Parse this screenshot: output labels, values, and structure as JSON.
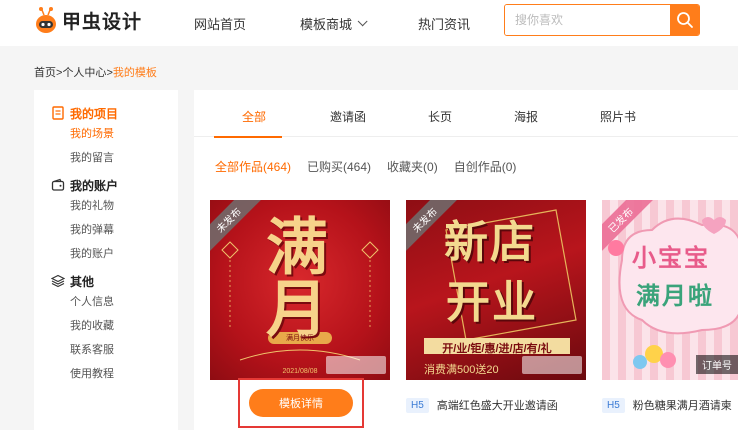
{
  "brand": {
    "name": "甲虫设计",
    "accent": "#ff7d1a"
  },
  "nav": [
    {
      "label": "网站首页"
    },
    {
      "label": "模板商城"
    },
    {
      "label": "热门资讯"
    }
  ],
  "search": {
    "placeholder": "搜你喜欢"
  },
  "breadcrumb": {
    "home": "首页",
    "sep1": ">",
    "center": "个人中心",
    "sep2": ">",
    "current": "我的模板"
  },
  "sidebar": {
    "sections": [
      {
        "title": "我的项目",
        "icon": "document-icon",
        "items": [
          "我的场景",
          "我的留言"
        ]
      },
      {
        "title": "我的账户",
        "icon": "wallet-icon",
        "items": [
          "我的礼物",
          "我的弹幕",
          "我的账户"
        ]
      },
      {
        "title": "其他",
        "icon": "layers-icon",
        "items": [
          "个人信息",
          "我的收藏",
          "联系客服",
          "使用教程"
        ]
      }
    ]
  },
  "tabs": [
    "全部",
    "邀请函",
    "长页",
    "海报",
    "照片书"
  ],
  "filters": [
    "全部作品(464)",
    "已购买(464)",
    "收藏夹(0)",
    "自创作品(0)"
  ],
  "cards": [
    {
      "status": "未发布",
      "poster_big": "满月",
      "poster_sub": "满月快乐",
      "poster_date": "2021/08/08",
      "detail_button": "模板详情"
    },
    {
      "status": "未发布",
      "poster_big_1": "新店",
      "poster_big_2": "开业",
      "poster_line": "开/业/钜/惠/进/店/有/礼",
      "poster_promo": "消费满500送20",
      "tag": "H5",
      "title": "高端红色盛大开业邀请函"
    },
    {
      "status": "已发布",
      "poster_big_1": "小宝宝",
      "poster_big_2": "满月啦",
      "order_tag": "订单号",
      "tag": "H5",
      "title": "粉色糖果满月酒请柬"
    }
  ]
}
